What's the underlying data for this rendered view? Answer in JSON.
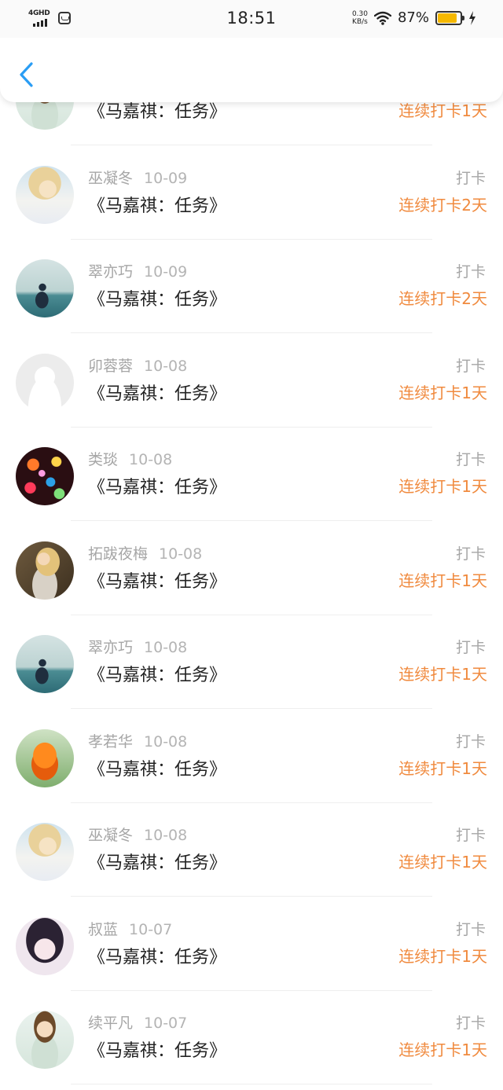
{
  "status_bar": {
    "network": "4GHD",
    "time": "18:51",
    "speed_value": "0.30",
    "speed_unit": "KB/s",
    "battery_percent": "87%",
    "battery_level": 0.87,
    "battery_color": "#f5b800"
  },
  "header": {
    "back_icon": "chevron-left-icon",
    "accent_color": "#2a9df4"
  },
  "list": {
    "streak_color": "#f08a3e",
    "rows": [
      {
        "avatar": "av-girl",
        "name": "",
        "date": "",
        "title": "《马嘉祺：任务》",
        "action": "",
        "streak": "连续打卡1天"
      },
      {
        "avatar": "av-toddler",
        "name": "巫凝冬",
        "date": "10-09",
        "title": "《马嘉祺：任务》",
        "action": "打卡",
        "streak": "连续打卡2天"
      },
      {
        "avatar": "av-sea",
        "name": "翠亦巧",
        "date": "10-09",
        "title": "《马嘉祺：任务》",
        "action": "打卡",
        "streak": "连续打卡2天"
      },
      {
        "avatar": "av-default",
        "name": "卯蓉蓉",
        "date": "10-08",
        "title": "《马嘉祺：任务》",
        "action": "打卡",
        "streak": "连续打卡1天"
      },
      {
        "avatar": "av-bokeh",
        "name": "类琰",
        "date": "10-08",
        "title": "《马嘉祺：任务》",
        "action": "打卡",
        "streak": "连续打卡1天"
      },
      {
        "avatar": "av-woman",
        "name": "拓跋夜梅",
        "date": "10-08",
        "title": "《马嘉祺：任务》",
        "action": "打卡",
        "streak": "连续打卡1天"
      },
      {
        "avatar": "av-sea",
        "name": "翠亦巧",
        "date": "10-08",
        "title": "《马嘉祺：任务》",
        "action": "打卡",
        "streak": "连续打卡1天"
      },
      {
        "avatar": "av-flower",
        "name": "孝若华",
        "date": "10-08",
        "title": "《马嘉祺：任务》",
        "action": "打卡",
        "streak": "连续打卡1天"
      },
      {
        "avatar": "av-toddler",
        "name": "巫凝冬",
        "date": "10-08",
        "title": "《马嘉祺：任务》",
        "action": "打卡",
        "streak": "连续打卡1天"
      },
      {
        "avatar": "av-anime",
        "name": "叔蓝",
        "date": "10-07",
        "title": "《马嘉祺：任务》",
        "action": "打卡",
        "streak": "连续打卡1天"
      },
      {
        "avatar": "av-girl",
        "name": "续平凡",
        "date": "10-07",
        "title": "《马嘉祺：任务》",
        "action": "打卡",
        "streak": "连续打卡1天"
      }
    ]
  }
}
